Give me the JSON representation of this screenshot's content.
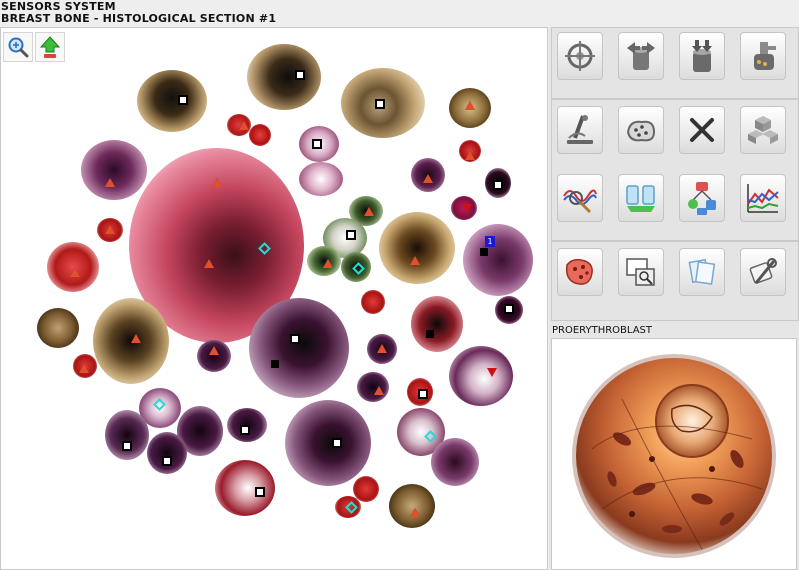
{
  "window": {
    "title_line1": "SENSORS  SYSTEM",
    "title_line2": "BREAST BONE - HISTOLOGICAL SECTION #1"
  },
  "toolbar": {
    "zoom_icon": "magnifier-zoom-icon",
    "upload_icon": "green-up-arrow-icon"
  },
  "markers": {
    "numbered_badge": "1"
  },
  "right_panel": {
    "row1_icons": [
      "target-reticle-icon",
      "spread-arrows-cylinder-icon",
      "converge-arrows-cylinder-icon",
      "dispenser-pot-icon"
    ],
    "row2_icons": [
      "microscope-icon",
      "dotted-cloud-icon",
      "cross-icon",
      "cubes-icon"
    ],
    "row3_icons": [
      "waveform-magnifier-icon",
      "lab-flasks-icon",
      "network-nodes-icon",
      "multi-line-chart-icon"
    ],
    "row4_icons": [
      "tissue-sample-icon",
      "window-zoom-icon",
      "papers-icon",
      "tools-icon"
    ],
    "preview_label": "PROERYTHROBLAST"
  },
  "colors": {
    "window_bg": "#eeeeee",
    "viewer_bg": "#ffffff",
    "marker_square": "#000000",
    "marker_triangle": "#e0502a",
    "marker_diamond": "#2ad8d8",
    "marker_badge": "#1a1ad0"
  }
}
